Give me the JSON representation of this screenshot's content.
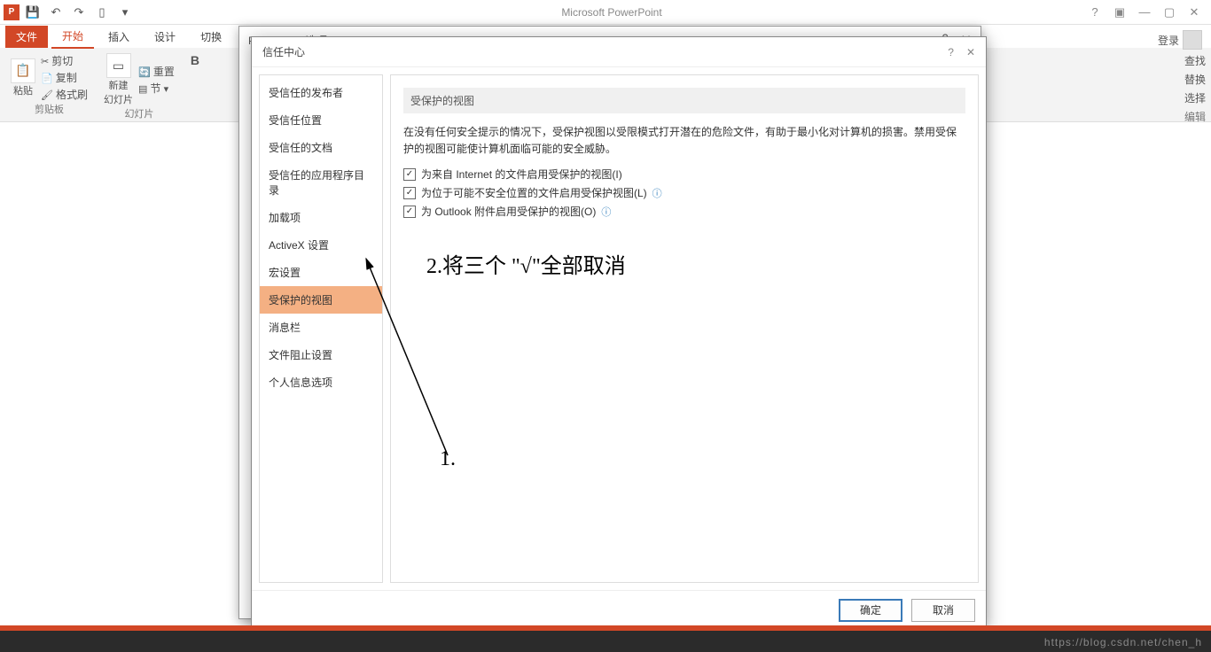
{
  "title": "Microsoft PowerPoint",
  "login": "登录",
  "tabs": {
    "file": "文件",
    "home": "开始",
    "insert": "插入",
    "design": "设计",
    "trans": "切换"
  },
  "ribbon": {
    "clipboard": "剪贴板",
    "cut": "剪切",
    "copy": "复制",
    "format": "格式刷",
    "paste": "粘贴",
    "slides": "幻灯片",
    "new": "新建\n幻灯片",
    "reset": "重置",
    "section": "节",
    "bold": "B",
    "right": {
      "find": "查找",
      "replace": "替换",
      "select": "选择",
      "edit": "编辑"
    }
  },
  "options_dialog": {
    "title": "PowerPoint 选项"
  },
  "dialog": {
    "title": "信任中心",
    "help": "?",
    "close": "✕",
    "side": [
      "受信任的发布者",
      "受信任位置",
      "受信任的文档",
      "受信任的应用程序目录",
      "加载项",
      "ActiveX 设置",
      "宏设置",
      "受保护的视图",
      "消息栏",
      "文件阻止设置",
      "个人信息选项"
    ],
    "section": "受保护的视图",
    "desc": "在没有任何安全提示的情况下，受保护视图以受限模式打开潜在的危险文件，有助于最小化对计算机的损害。禁用受保护的视图可能使计算机面临可能的安全威胁。",
    "chk1": "为来自 Internet 的文件启用受保护的视图(I)",
    "chk2": "为位于可能不安全位置的文件启用受保护视图(L)",
    "chk3": "为 Outlook 附件启用受保护的视图(O)",
    "ok": "确定",
    "cancel": "取消"
  },
  "annotations": {
    "a1": "1.",
    "a2": "2.将三个 \"√\"全部取消"
  },
  "watermark": "https://blog.csdn.net/chen_h"
}
